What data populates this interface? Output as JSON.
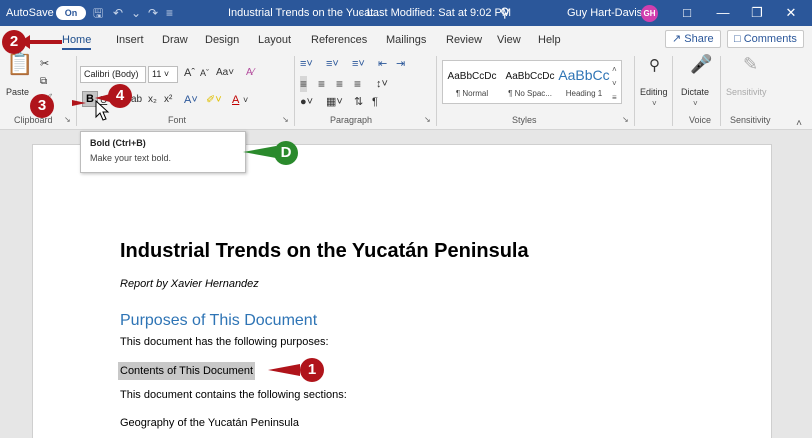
{
  "titlebar": {
    "autosave_label": "AutoSave",
    "autosave_state": "On",
    "doc_title": "Industrial Trends on the Yucat...",
    "modified": "- Last Modified: Sat at 9:02 PM",
    "user_name": "Guy Hart-Davis",
    "user_initials": "GH"
  },
  "tabs": [
    "Home",
    "Insert",
    "Draw",
    "Design",
    "Layout",
    "References",
    "Mailings",
    "Review",
    "View",
    "Help"
  ],
  "share_label": "Share",
  "comments_label": "Comments",
  "ribbon": {
    "paste_label": "Paste",
    "font_name": "Calibri (Body)",
    "font_size": "11",
    "groups": {
      "clipboard": "Clipboard",
      "font": "Font",
      "paragraph": "Paragraph",
      "styles": "Styles",
      "voice": "Voice",
      "sensitivity": "Sensitivity"
    },
    "styles_gallery": [
      {
        "sample": "AaBbCcDc",
        "name": "¶ Normal"
      },
      {
        "sample": "AaBbCcDc",
        "name": "¶ No Spac..."
      },
      {
        "sample": "AaBbCc",
        "name": "Heading 1"
      }
    ],
    "editing_label": "Editing",
    "dictate_label": "Dictate",
    "sensitivity_label": "Sensitivity"
  },
  "tooltip": {
    "title": "Bold (Ctrl+B)",
    "description": "Make your text bold."
  },
  "document": {
    "title": "Industrial Trends on the Yucatán Peninsula",
    "subtitle": "Report by Xavier Hernandez",
    "heading": "Purposes of This Document",
    "p1": "This document has the following purposes:",
    "p2": "Contents of This Document",
    "p3": "This document contains the following sections:",
    "p4": "Geography of the Yucatán Peninsula"
  },
  "callouts": {
    "c1": "1",
    "c2": "2",
    "c3": "3",
    "c4": "4",
    "cD": "D"
  },
  "colors": {
    "titlebar": "#2b579a",
    "callout_red": "#b0141b",
    "callout_green": "#2a8a2c",
    "heading_blue": "#2e74b5"
  }
}
